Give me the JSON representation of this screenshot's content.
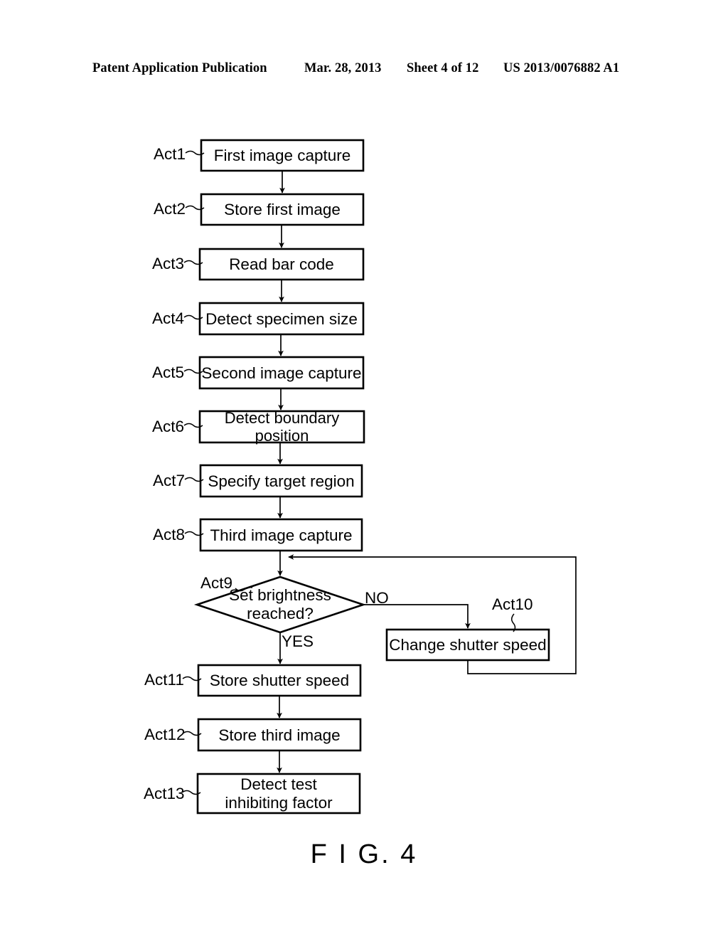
{
  "header": {
    "publication": "Patent Application Publication",
    "date": "Mar. 28, 2013",
    "sheet": "Sheet 4 of 12",
    "document_number": "US 2013/0076882 A1"
  },
  "figure": {
    "caption": "F I G. 4",
    "type": "flowchart"
  },
  "flowchart": {
    "nodes": [
      {
        "id": "act1",
        "ref": "Act1",
        "shape": "process",
        "text": "First image capture"
      },
      {
        "id": "act2",
        "ref": "Act2",
        "shape": "process",
        "text": "Store first image"
      },
      {
        "id": "act3",
        "ref": "Act3",
        "shape": "process",
        "text": "Read bar code"
      },
      {
        "id": "act4",
        "ref": "Act4",
        "shape": "process",
        "text": "Detect specimen size"
      },
      {
        "id": "act5",
        "ref": "Act5",
        "shape": "process",
        "text": "Second image capture"
      },
      {
        "id": "act6",
        "ref": "Act6",
        "shape": "process",
        "text": "Detect boundary position"
      },
      {
        "id": "act7",
        "ref": "Act7",
        "shape": "process",
        "text": "Specify target region"
      },
      {
        "id": "act8",
        "ref": "Act8",
        "shape": "process",
        "text": "Third image capture"
      },
      {
        "id": "act9",
        "ref": "Act9",
        "shape": "decision",
        "text": "Set brightness\nreached?"
      },
      {
        "id": "act10",
        "ref": "Act10",
        "shape": "process",
        "text": "Change shutter speed"
      },
      {
        "id": "act11",
        "ref": "Act11",
        "shape": "process",
        "text": "Store shutter speed"
      },
      {
        "id": "act12",
        "ref": "Act12",
        "shape": "process",
        "text": "Store third image"
      },
      {
        "id": "act13",
        "ref": "Act13",
        "shape": "process",
        "text": "Detect test\ninhibiting factor"
      }
    ],
    "branch_labels": {
      "yes": "YES",
      "no": "NO"
    },
    "edges": [
      {
        "from": "act1",
        "to": "act2",
        "label": ""
      },
      {
        "from": "act2",
        "to": "act3",
        "label": ""
      },
      {
        "from": "act3",
        "to": "act4",
        "label": ""
      },
      {
        "from": "act4",
        "to": "act5",
        "label": ""
      },
      {
        "from": "act5",
        "to": "act6",
        "label": ""
      },
      {
        "from": "act6",
        "to": "act7",
        "label": ""
      },
      {
        "from": "act7",
        "to": "act8",
        "label": ""
      },
      {
        "from": "act8",
        "to": "act9",
        "label": ""
      },
      {
        "from": "act9",
        "to": "act11",
        "label": "YES"
      },
      {
        "from": "act9",
        "to": "act10",
        "label": "NO"
      },
      {
        "from": "act10",
        "to": "act9",
        "label": ""
      },
      {
        "from": "act11",
        "to": "act12",
        "label": ""
      },
      {
        "from": "act12",
        "to": "act13",
        "label": ""
      }
    ]
  }
}
